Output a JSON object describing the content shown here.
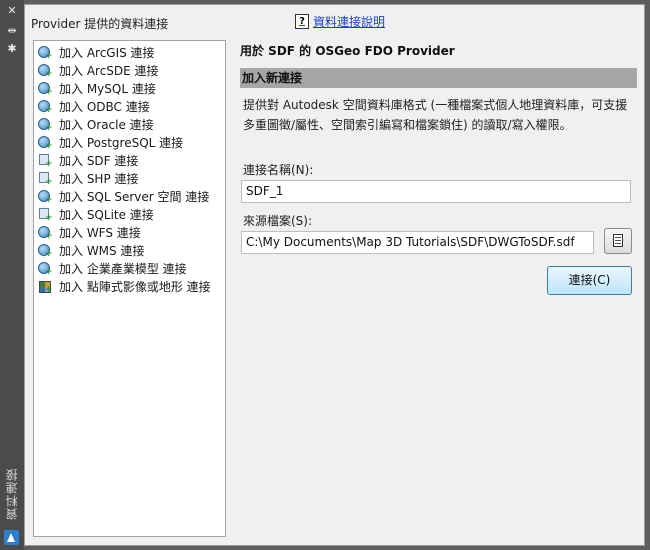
{
  "side_strip": {
    "title": "資料連接",
    "buttons": [
      "close-icon",
      "pin-icon",
      "settings-icon"
    ]
  },
  "header": {
    "provider_label": "Provider 提供的資料連接",
    "help_link": "資料連接說明"
  },
  "providers": [
    {
      "label": "加入 ArcGIS 連接",
      "icon": "globe"
    },
    {
      "label": "加入 ArcSDE 連接",
      "icon": "globe"
    },
    {
      "label": "加入 MySQL 連接",
      "icon": "globe"
    },
    {
      "label": "加入 ODBC 連接",
      "icon": "globe"
    },
    {
      "label": "加入 Oracle 連接",
      "icon": "globe"
    },
    {
      "label": "加入 PostgreSQL 連接",
      "icon": "globe"
    },
    {
      "label": "加入 SDF 連接",
      "icon": "doc"
    },
    {
      "label": "加入 SHP 連接",
      "icon": "doc"
    },
    {
      "label": "加入 SQL Server 空間 連接",
      "icon": "globe"
    },
    {
      "label": "加入 SQLite 連接",
      "icon": "doc"
    },
    {
      "label": "加入 WFS 連接",
      "icon": "globe"
    },
    {
      "label": "加入 WMS 連接",
      "icon": "globe"
    },
    {
      "label": "加入 企業產業模型 連接",
      "icon": "globe"
    },
    {
      "label": "加入 點陣式影像或地形 連接",
      "icon": "grid"
    }
  ],
  "details": {
    "title": "用於 SDF 的 OSGeo FDO Provider",
    "section_title": "加入新連接",
    "description": "提供對 Autodesk 空間資料庫格式 (一種檔案式個人地理資料庫，可支援多重圖徵/屬性、空間索引編寫和檔案鎖住) 的讀取/寫入權限。",
    "connection_name_label": "連接名稱(N):",
    "connection_name_value": "SDF_1",
    "source_file_label": "來源檔案(S):",
    "source_file_value": "C:\\My Documents\\Map 3D Tutorials\\SDF\\DWGToSDF.sdf",
    "connect_button": "連接(C)"
  }
}
